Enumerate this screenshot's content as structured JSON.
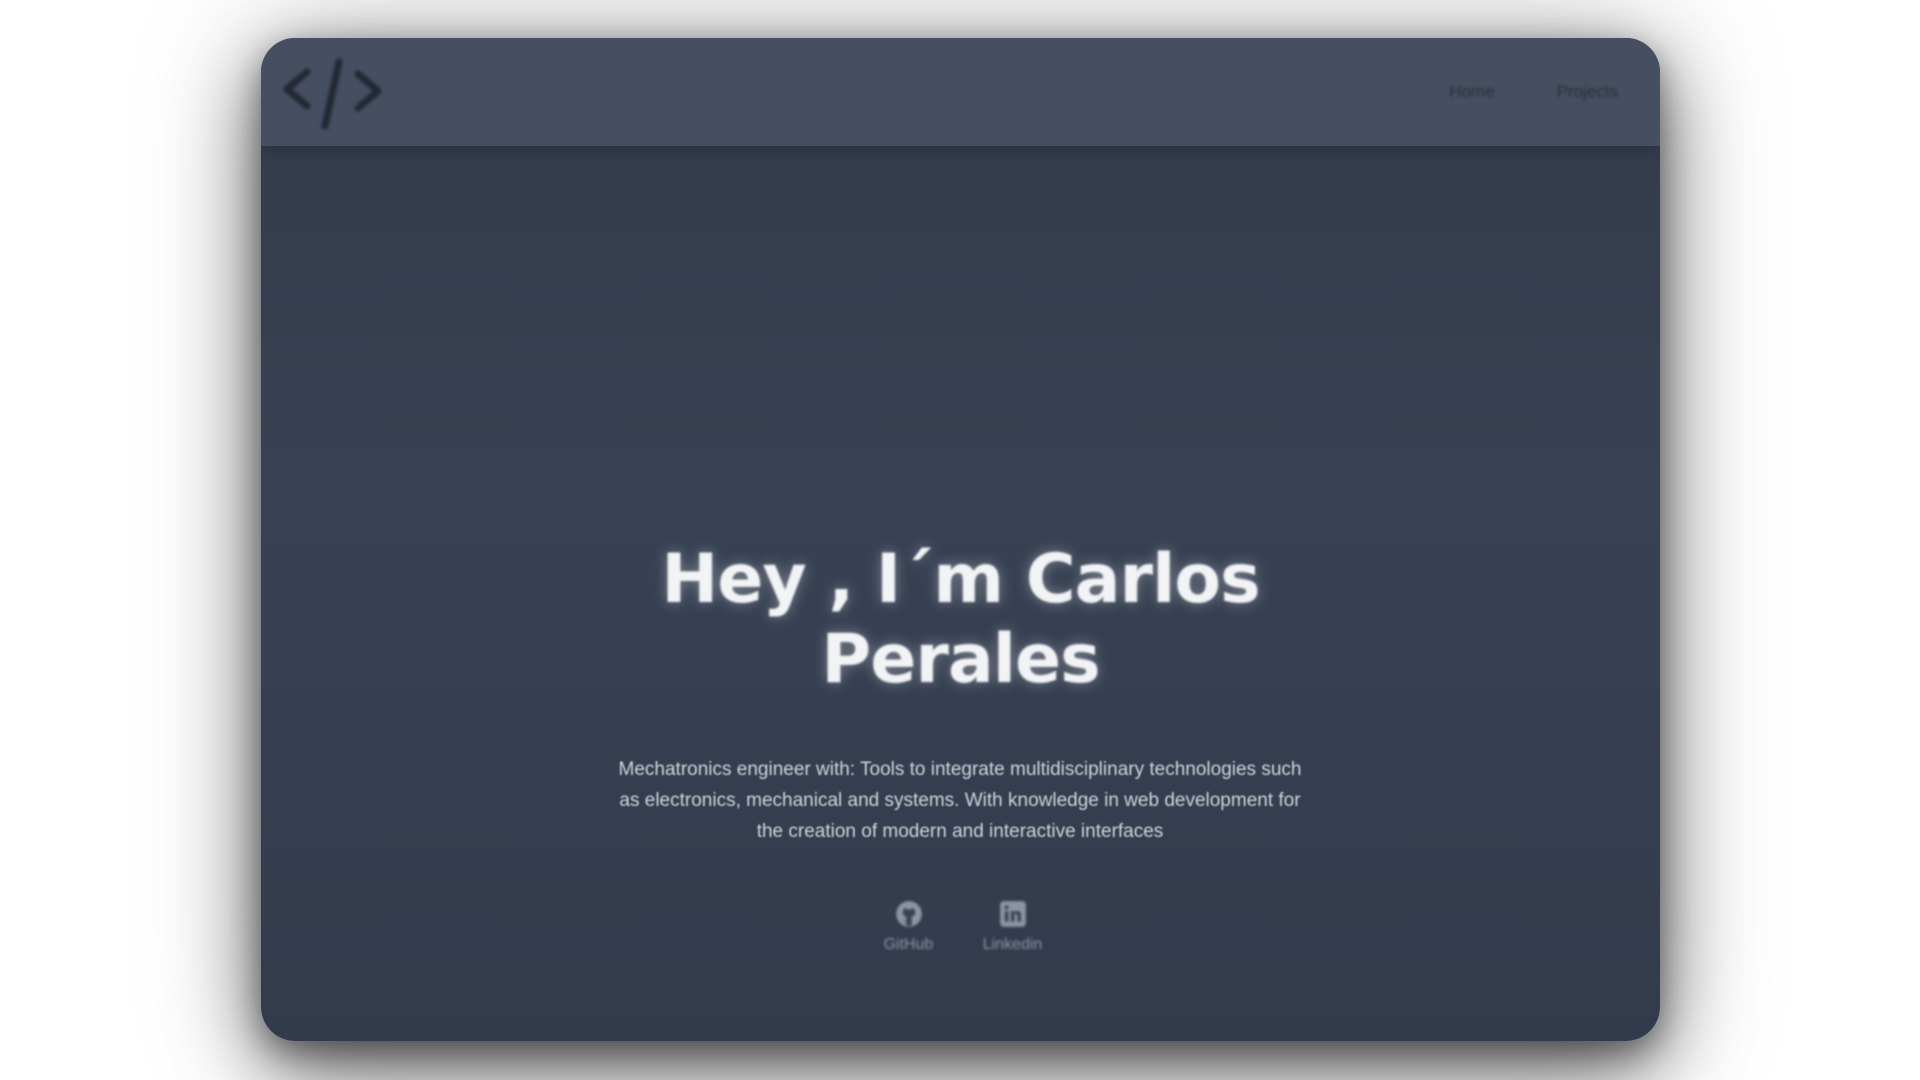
{
  "navbar": {
    "logo_icon": "code-brackets-icon",
    "links": [
      {
        "label": "Home"
      },
      {
        "label": "Projects"
      }
    ]
  },
  "hero": {
    "title_line1": "Hey , I´m Carlos",
    "title_line2": "Perales",
    "description": "Mechatronics engineer with: Tools to integrate multidisciplinary technologies such as electronics, mechanical and systems. With knowledge in web development for the creation of modern and interactive interfaces"
  },
  "socials": [
    {
      "label": "GitHub",
      "icon": "github-icon"
    },
    {
      "label": "Linkedin",
      "icon": "linkedin-icon"
    }
  ],
  "colors": {
    "background": "#ffffff",
    "card": "#384254",
    "navbar": "#454f61",
    "title": "#f2f3f5",
    "text": "#cfd3da",
    "muted": "#8c95a4"
  }
}
